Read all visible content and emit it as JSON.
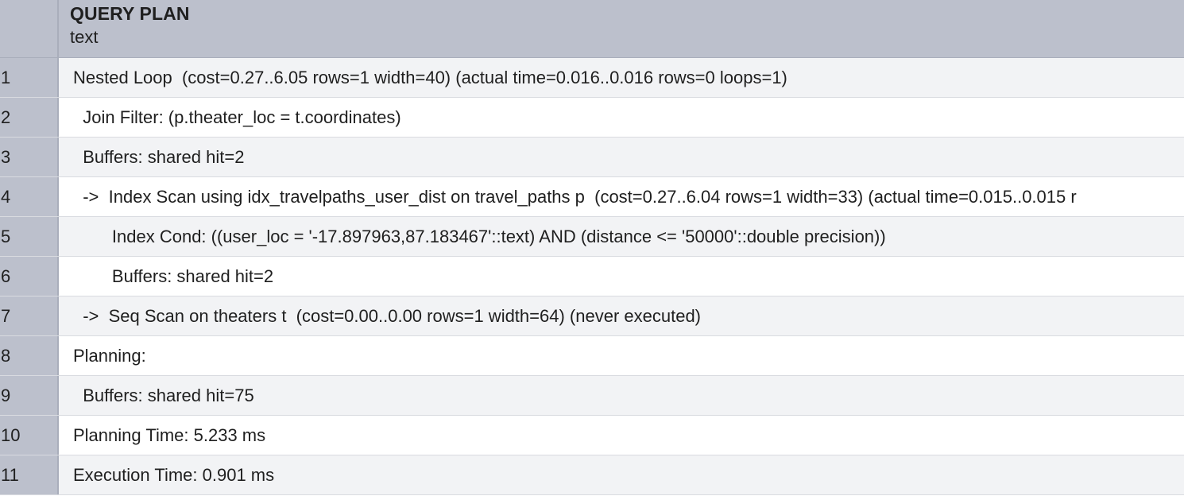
{
  "column": {
    "name": "QUERY PLAN",
    "type": "text"
  },
  "rows": [
    {
      "num": "1",
      "text": "Nested Loop  (cost=0.27..6.05 rows=1 width=40) (actual time=0.016..0.016 rows=0 loops=1)"
    },
    {
      "num": "2",
      "text": "  Join Filter: (p.theater_loc = t.coordinates)"
    },
    {
      "num": "3",
      "text": "  Buffers: shared hit=2"
    },
    {
      "num": "4",
      "text": "  ->  Index Scan using idx_travelpaths_user_dist on travel_paths p  (cost=0.27..6.04 rows=1 width=33) (actual time=0.015..0.015 r"
    },
    {
      "num": "5",
      "text": "        Index Cond: ((user_loc = '-17.897963,87.183467'::text) AND (distance <= '50000'::double precision))"
    },
    {
      "num": "6",
      "text": "        Buffers: shared hit=2"
    },
    {
      "num": "7",
      "text": "  ->  Seq Scan on theaters t  (cost=0.00..0.00 rows=1 width=64) (never executed)"
    },
    {
      "num": "8",
      "text": "Planning:"
    },
    {
      "num": "9",
      "text": "  Buffers: shared hit=75"
    },
    {
      "num": "10",
      "text": "Planning Time: 5.233 ms"
    },
    {
      "num": "11",
      "text": "Execution Time: 0.901 ms"
    }
  ]
}
